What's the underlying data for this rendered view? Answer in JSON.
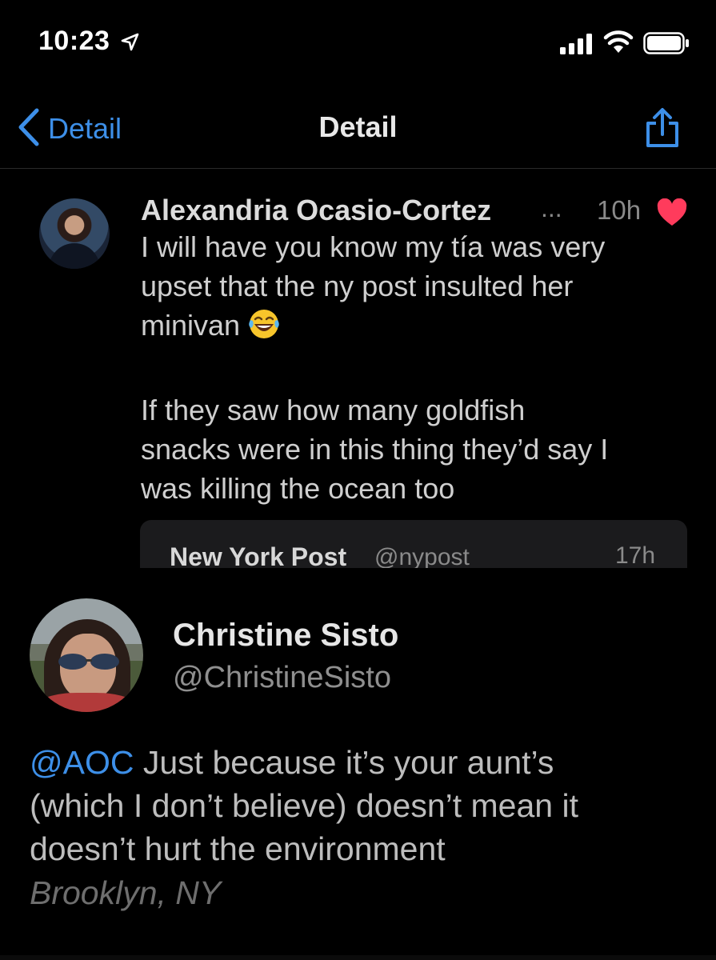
{
  "status_bar": {
    "time": "10:23",
    "icons": [
      "location-arrow-icon",
      "cellular-signal-icon",
      "wifi-icon",
      "battery-icon"
    ]
  },
  "nav": {
    "back_label": "Detail",
    "title": "Detail",
    "share_icon": "share-icon",
    "accent_color": "#3d8fe8"
  },
  "tweet": {
    "author": "Alexandria Ocasio-Cortez",
    "author_truncation": "...",
    "time": "10h",
    "liked": true,
    "like_color": "#ff3b5c",
    "line1": "I will have you know my tía was very",
    "line2": "upset that the ny post insulted her",
    "line3": "minivan",
    "emoji": "laughing-tears-emoji",
    "para2_line1": "If they saw how many goldfish",
    "para2_line2": "snacks were in this thing they’d say I",
    "para2_line3": "was killing the ocean too",
    "quoted": {
      "name": "New York Post",
      "handle": "@nypost",
      "time": "17h"
    }
  },
  "reply": {
    "name": "Christine Sisto",
    "handle": "@ChristineSisto",
    "mention": "@AOC",
    "text_line1": " Just because it’s your aunt’s",
    "text_line2": "(which I don’t believe) doesn’t mean it",
    "text_line3": "doesn’t hurt the environment",
    "location": "Brooklyn, NY"
  }
}
